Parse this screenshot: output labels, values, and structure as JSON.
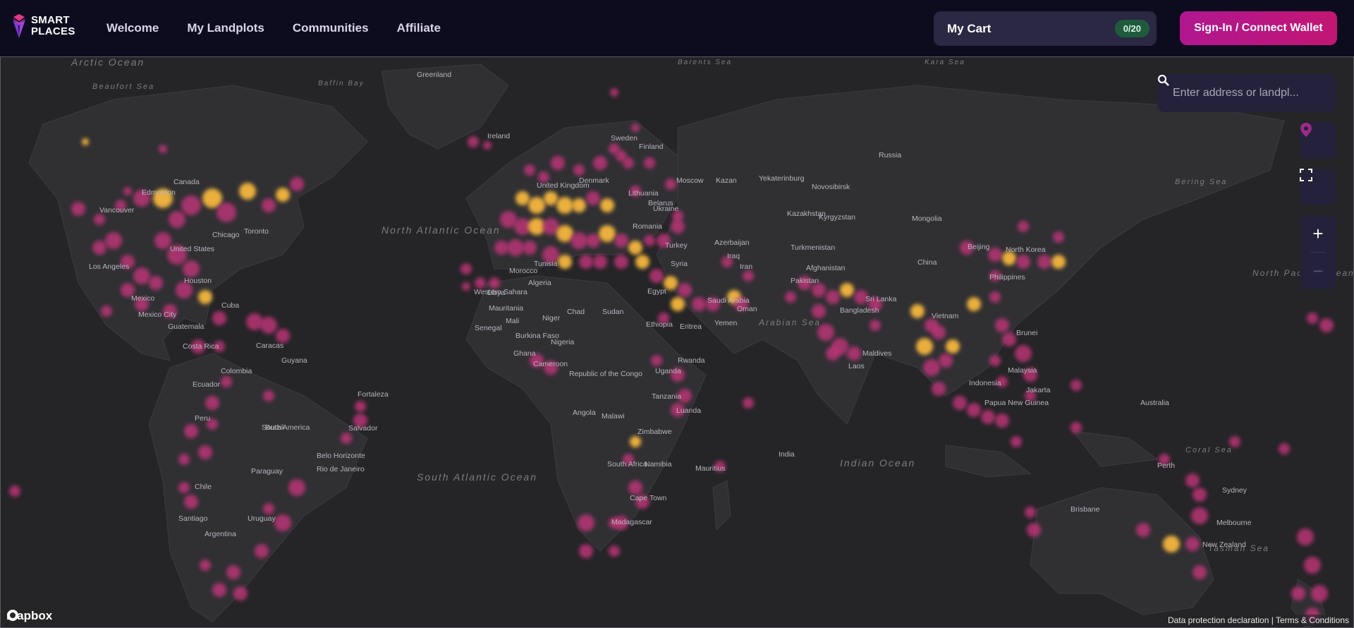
{
  "header": {
    "logo_line1": "SMART",
    "logo_line2": "PLACES",
    "nav": [
      "Welcome",
      "My Landplots",
      "Communities",
      "Affiliate"
    ],
    "cart_label": "My Cart",
    "cart_count": "0/20",
    "signin_label": "Sign-In / Connect Wallet"
  },
  "map": {
    "search_placeholder": "Enter address or landpl...",
    "mapbox_label": "mapbox",
    "attribution": [
      "Data protection declaration",
      "Terms & Conditions"
    ],
    "attribution_sep": " | ",
    "zoom_in": "+",
    "zoom_out": "−",
    "oceans": [
      "Arctic Ocean",
      "Beaufort Sea",
      "North Atlantic Ocean",
      "South Atlantic Ocean",
      "Indian Ocean",
      "Arabian Sea",
      "North Pacific Ocean",
      "Coral Sea",
      "Tasman Sea",
      "Bering Sea",
      "Baffin Bay",
      "Barents Sea",
      "Kara Sea"
    ],
    "places": [
      "Greenland",
      "Canada",
      "Edmonton",
      "Vancouver",
      "United States",
      "Los Angeles",
      "Houston",
      "Chicago",
      "Toronto",
      "Mexico",
      "Mexico City",
      "Guatemala",
      "Cuba",
      "Costa Rica",
      "Caracas",
      "Colombia",
      "Ecuador",
      "Guyana",
      "Peru",
      "Brazil",
      "Fortaleza",
      "Salvador",
      "Belo Horizonte",
      "Rio de Janeiro",
      "Paraguay",
      "Chile",
      "Santiago",
      "Uruguay",
      "Argentina",
      "South America",
      "Ireland",
      "United Kingdom",
      "Sweden",
      "Finland",
      "Denmark",
      "Lithuania",
      "Belarus",
      "Moscow",
      "Kazan",
      "Yekaterinburg",
      "Novosibirsk",
      "Russia",
      "Ukraine",
      "Romania",
      "Turkey",
      "Syria",
      "Azerbaijan",
      "Turkmenistan",
      "Kazakhstan",
      "Kyrgyzstan",
      "Mongolia",
      "China",
      "Beijing",
      "North Korea",
      "Afghanistan",
      "Pakistan",
      "Iran",
      "Iraq",
      "Egypt",
      "Saudi Arabia",
      "Oman",
      "Yemen",
      "Eritrea",
      "Ethiopia",
      "Sudan",
      "Chad",
      "Niger",
      "Libya",
      "Algeria",
      "Tunisia",
      "Morocco",
      "Western Sahara",
      "Mauritania",
      "Mali",
      "Senegal",
      "Burkina Faso",
      "Ghana",
      "Nigeria",
      "Cameroon",
      "Republic of the Congo",
      "Uganda",
      "Tanzania",
      "Rwanda",
      "Luanda",
      "Angola",
      "Malawi",
      "Zimbabwe",
      "Namibia",
      "South Africa",
      "Cape Town",
      "Madagascar",
      "Mauritius",
      "India",
      "Bangladesh",
      "Sri Lanka",
      "Maldives",
      "Laos",
      "Vietnam",
      "Philippines",
      "Brunei",
      "Malaysia",
      "Indonesia",
      "Jakarta",
      "Papua New Guinea",
      "Australia",
      "Perth",
      "Brisbane",
      "Sydney",
      "Melbourne",
      "New Zealand"
    ]
  },
  "colors": {
    "header_bg": "#0d0c1f",
    "map_bg": "#252527",
    "land": "#303033",
    "heat_low": "#c2347a",
    "heat_high": "#f4b63c",
    "accent": "#b0178f"
  }
}
